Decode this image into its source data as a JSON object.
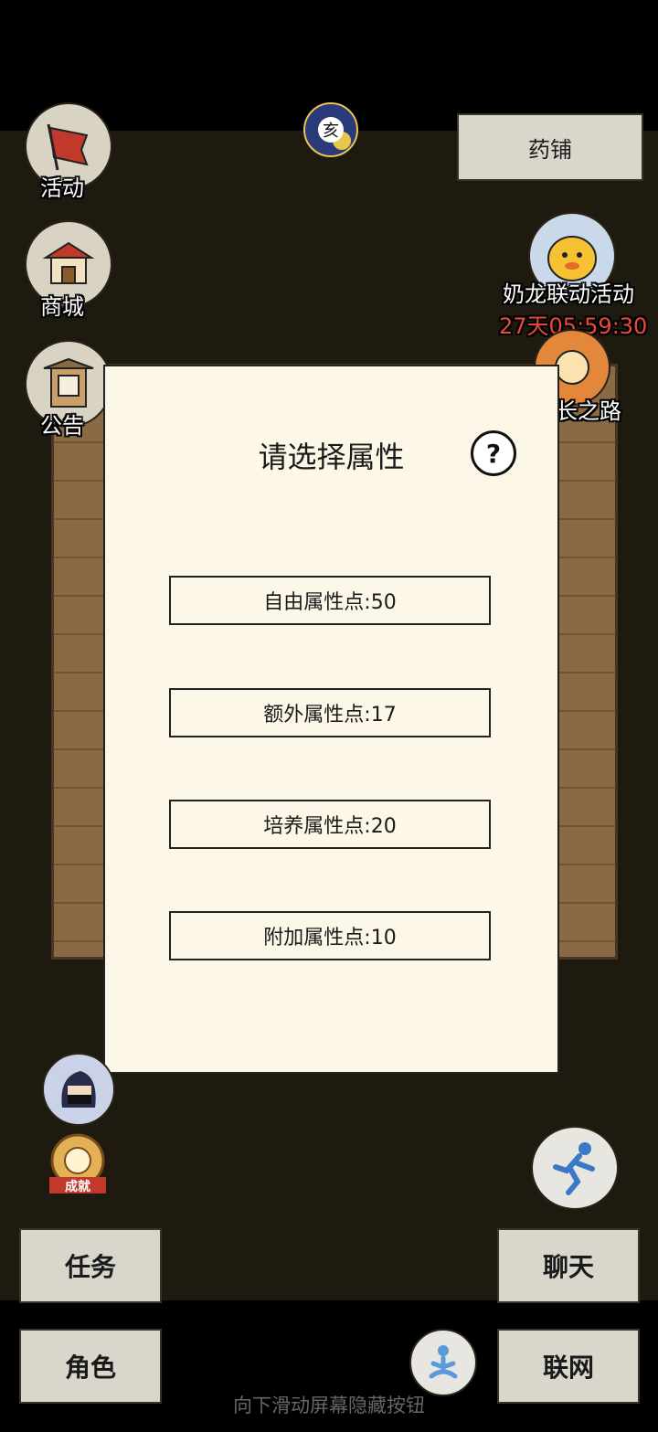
{
  "top_right": {
    "shop_button": "药铺"
  },
  "left_menu": [
    {
      "label": "活动",
      "icon": "flag-icon"
    },
    {
      "label": "商城",
      "icon": "store-icon"
    },
    {
      "label": "公告",
      "icon": "notice-board-icon"
    }
  ],
  "time_badge": {
    "label": "亥"
  },
  "event": {
    "label": "奶龙联动活动",
    "countdown": "27天05:59:30"
  },
  "growth": {
    "label": "长之路"
  },
  "dialog": {
    "title": "请选择属性",
    "help_glyph": "?",
    "attributes": [
      {
        "label": "自由属性点:50"
      },
      {
        "label": "额外属性点:17"
      },
      {
        "label": "培养属性点:20"
      },
      {
        "label": "附加属性点:10"
      }
    ]
  },
  "achievement": {
    "label": "成就"
  },
  "bottom_buttons": {
    "task": "任务",
    "chat": "聊天",
    "character": "角色",
    "network": "联网"
  },
  "hint": "向下滑动屏幕隐藏按钮",
  "colors": {
    "dialog_bg": "#fdf7e7",
    "button_bg": "#d9d6cc",
    "countdown": "#e84a3a",
    "page_bg": "#1e1a0f"
  }
}
